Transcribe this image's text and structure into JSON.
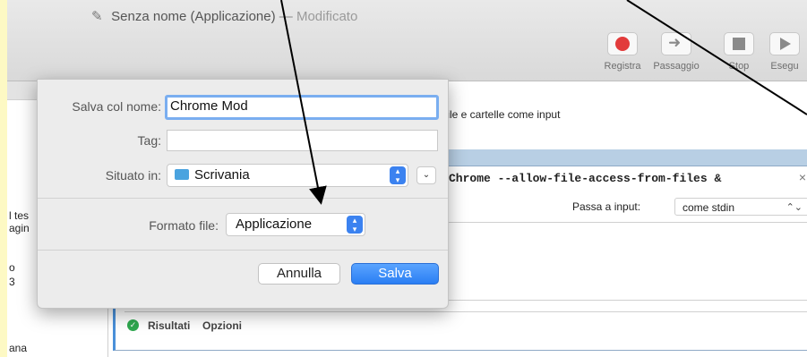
{
  "window": {
    "title": "Senza nome (Applicazione)",
    "separator": "—",
    "modified": "Modificato"
  },
  "toolbar": {
    "record": "Registra",
    "step": "Passaggio",
    "stop": "Stop",
    "run": "Esegu"
  },
  "sidebar": {
    "items": [
      "l tes",
      "agin",
      "o",
      "3",
      "ana"
    ]
  },
  "workflow": {
    "input_note": "file e cartelle come input",
    "pass_input_label": "Passa a input:",
    "pass_input_value": "come stdin",
    "code": "Chrome --allow-file-access-from-files &",
    "results_tab": "Risultati",
    "options_tab": "Opzioni"
  },
  "save_dialog": {
    "save_as_label": "Salva col nome:",
    "save_as_value": "Chrome Mod",
    "tags_label": "Tag:",
    "tags_value": "",
    "location_label": "Situato in:",
    "location_value": "Scrivania",
    "format_label": "Formato file:",
    "format_value": "Applicazione",
    "cancel_label": "Annulla",
    "save_label": "Salva"
  },
  "colors": {
    "background": "#fdf9c4",
    "accent": "#3b82f0",
    "record": "#e23b3b"
  }
}
